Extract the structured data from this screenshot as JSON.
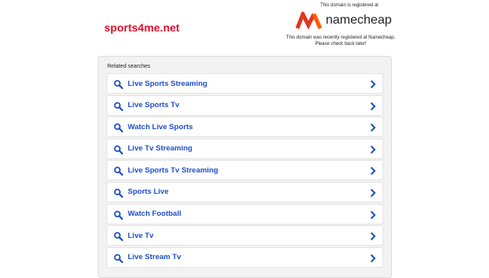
{
  "header": {
    "domain": "sports4me.net",
    "registered_label": "This domain is registered at",
    "brand_name": "namecheap",
    "note_line1": "This domain was recently registered at Namecheap.",
    "note_line2": "Please check back later!"
  },
  "related": {
    "title": "Related searches",
    "items": [
      {
        "label": "Live Sports Streaming"
      },
      {
        "label": "Live Sports Tv"
      },
      {
        "label": "Watch Live Sports"
      },
      {
        "label": "Live Tv Streaming"
      },
      {
        "label": "Live Sports Tv Streaming"
      },
      {
        "label": "Sports Live"
      },
      {
        "label": "Watch Football"
      },
      {
        "label": "Live Tv"
      },
      {
        "label": "Live Stream Tv"
      }
    ]
  },
  "colors": {
    "domain": "#e0102e",
    "link": "#1e4fc9",
    "brand_orange": "#ff5100",
    "brand_red": "#de3723"
  }
}
